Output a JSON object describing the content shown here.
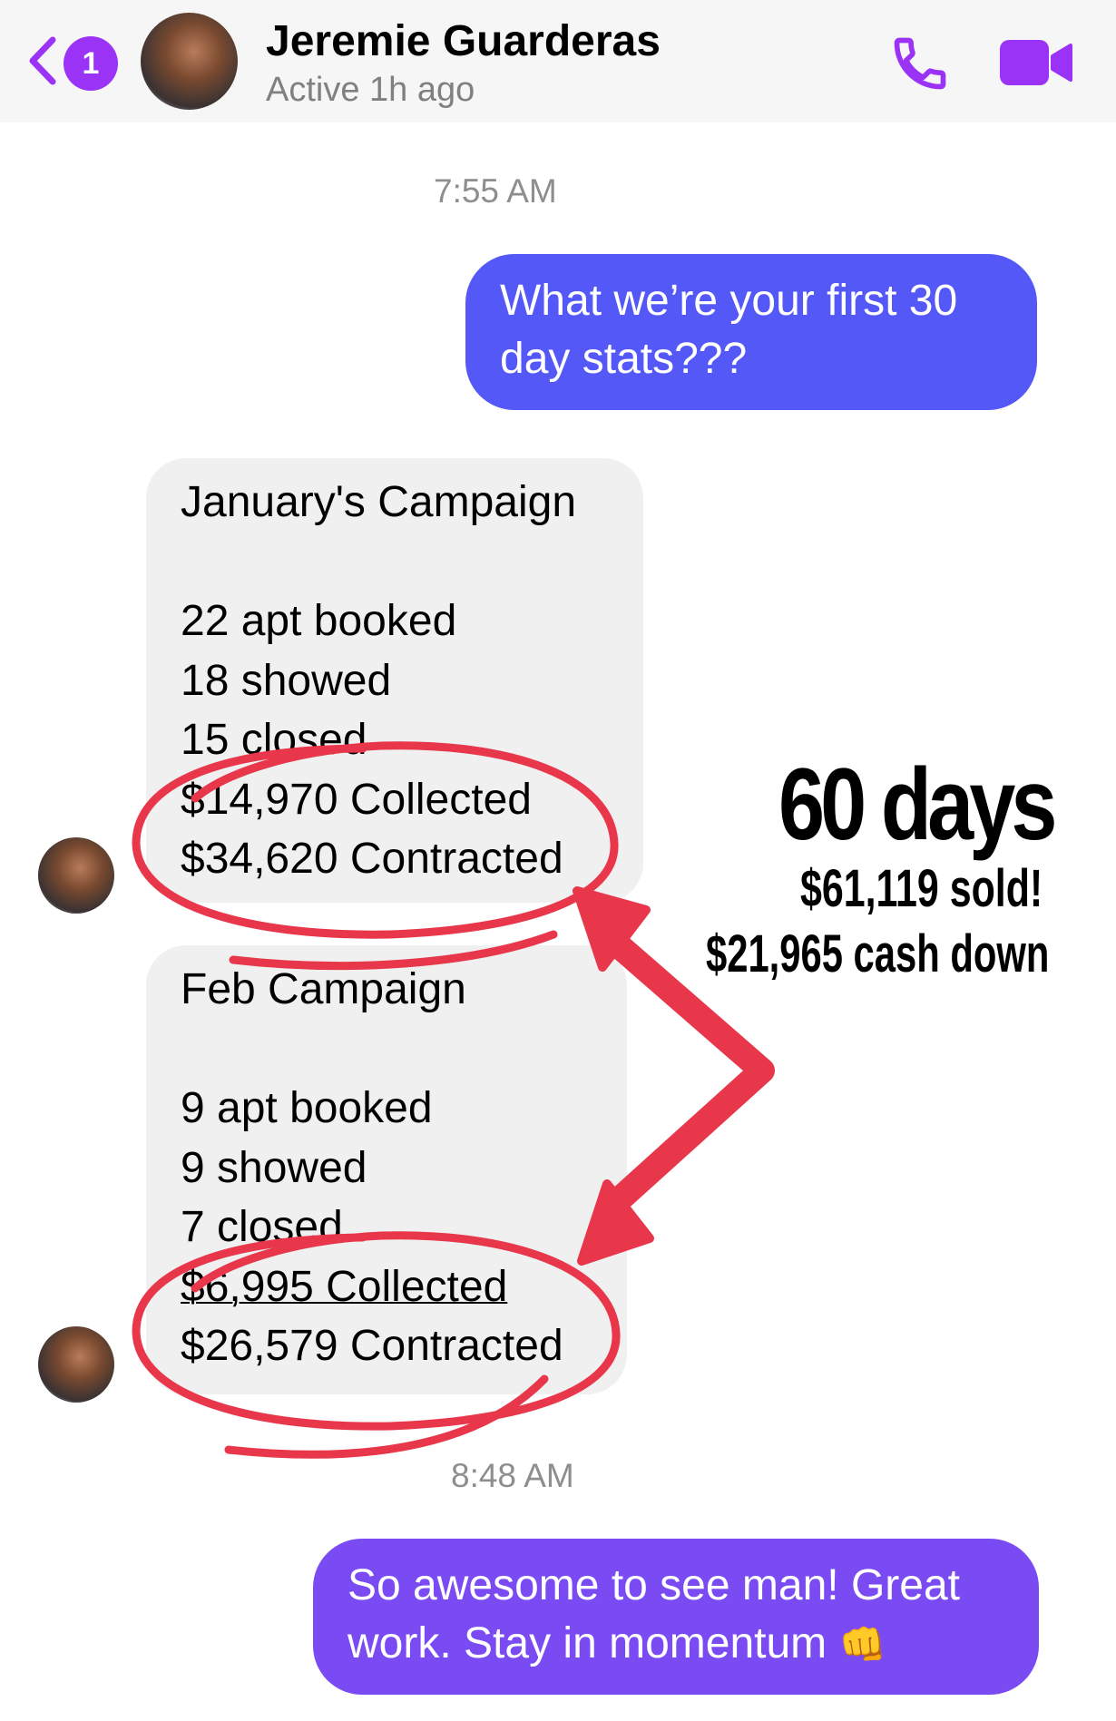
{
  "header": {
    "back_badge": "1",
    "contact_name": "Jeremie Guarderas",
    "contact_status": "Active 1h ago"
  },
  "conversation": {
    "timestamp_1": "7:55 AM",
    "outgoing_1": [
      "What we’re your first 30",
      "day stats???"
    ],
    "incoming_1": [
      "January's Campaign",
      "",
      "22 apt booked",
      "18 showed",
      "15 closed",
      "$14,970 Collected",
      "$34,620 Contracted"
    ],
    "incoming_2": [
      "Feb Campaign",
      "",
      "9 apt booked",
      "9 showed",
      "7 closed",
      "$6,995 Collected",
      "$26,579 Contracted"
    ],
    "timestamp_2": "8:48 AM",
    "outgoing_2": [
      "So awesome to see man!  Great",
      "work.  Stay in momentum"
    ],
    "outgoing_2_emoji": "👊"
  },
  "annotation": {
    "title": "60 days",
    "sold": "$61,119 sold!",
    "cash": "$21,965 cash down",
    "ink_color": "#e8374a"
  },
  "colors": {
    "accent": "#9a33f5",
    "bubble_out_1": "#5458f7",
    "bubble_out_2": "#7a4bf3",
    "bubble_in": "#f0f0f0"
  },
  "icons": {
    "back": "chevron-left-icon",
    "call": "phone-icon",
    "video": "video-camera-icon"
  }
}
